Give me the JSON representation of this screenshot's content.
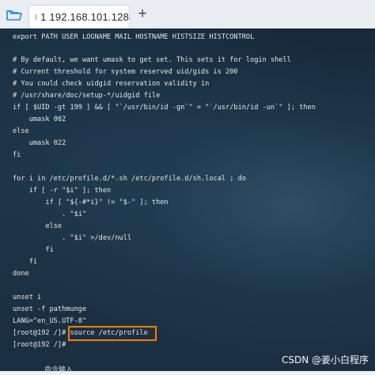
{
  "tabbar": {
    "tab_label": "1 192.168.101.128",
    "add_symbol": "+"
  },
  "terminal": {
    "lines": [
      "export PATH USER LOGNAME MAIL HOSTNAME HISTSIZE HISTCONTROL",
      "",
      "# By default, we want umask to get set. This sets it for login shell",
      "# Current threshold for system reserved uid/gids is 200",
      "# You could check uidgid reservation validity in",
      "# /usr/share/doc/setup-*/uidgid file",
      "if [ $UID -gt 199 ] && [ \"`/usr/bin/id -gn`\" = \"`/usr/bin/id -un`\" ]; then",
      "    umask 002",
      "else",
      "    umask 022",
      "fi",
      "",
      "for i in /etc/profile.d/*.sh /etc/profile.d/sh.local ; do",
      "    if [ -r \"$i\" ]; then",
      "        if [ \"${-#*i}\" != \"$-\" ]; then",
      "            . \"$i\"",
      "        else",
      "            . \"$i\" >/dev/null",
      "        fi",
      "    fi",
      "done",
      "",
      "unset i",
      "unset -f pathmunge",
      "LANG=\"en_US.UTF-8\"",
      "[root@192 /]# source /etc/profile",
      "[root@192 /]# "
    ],
    "partial_bottom_text": "命令输入"
  },
  "watermark": "CSDN @姜小白程序",
  "colors": {
    "tab_status": "#2fbf5b",
    "folder_icon": "#1e88e5",
    "highlight": "#ff7a00"
  }
}
